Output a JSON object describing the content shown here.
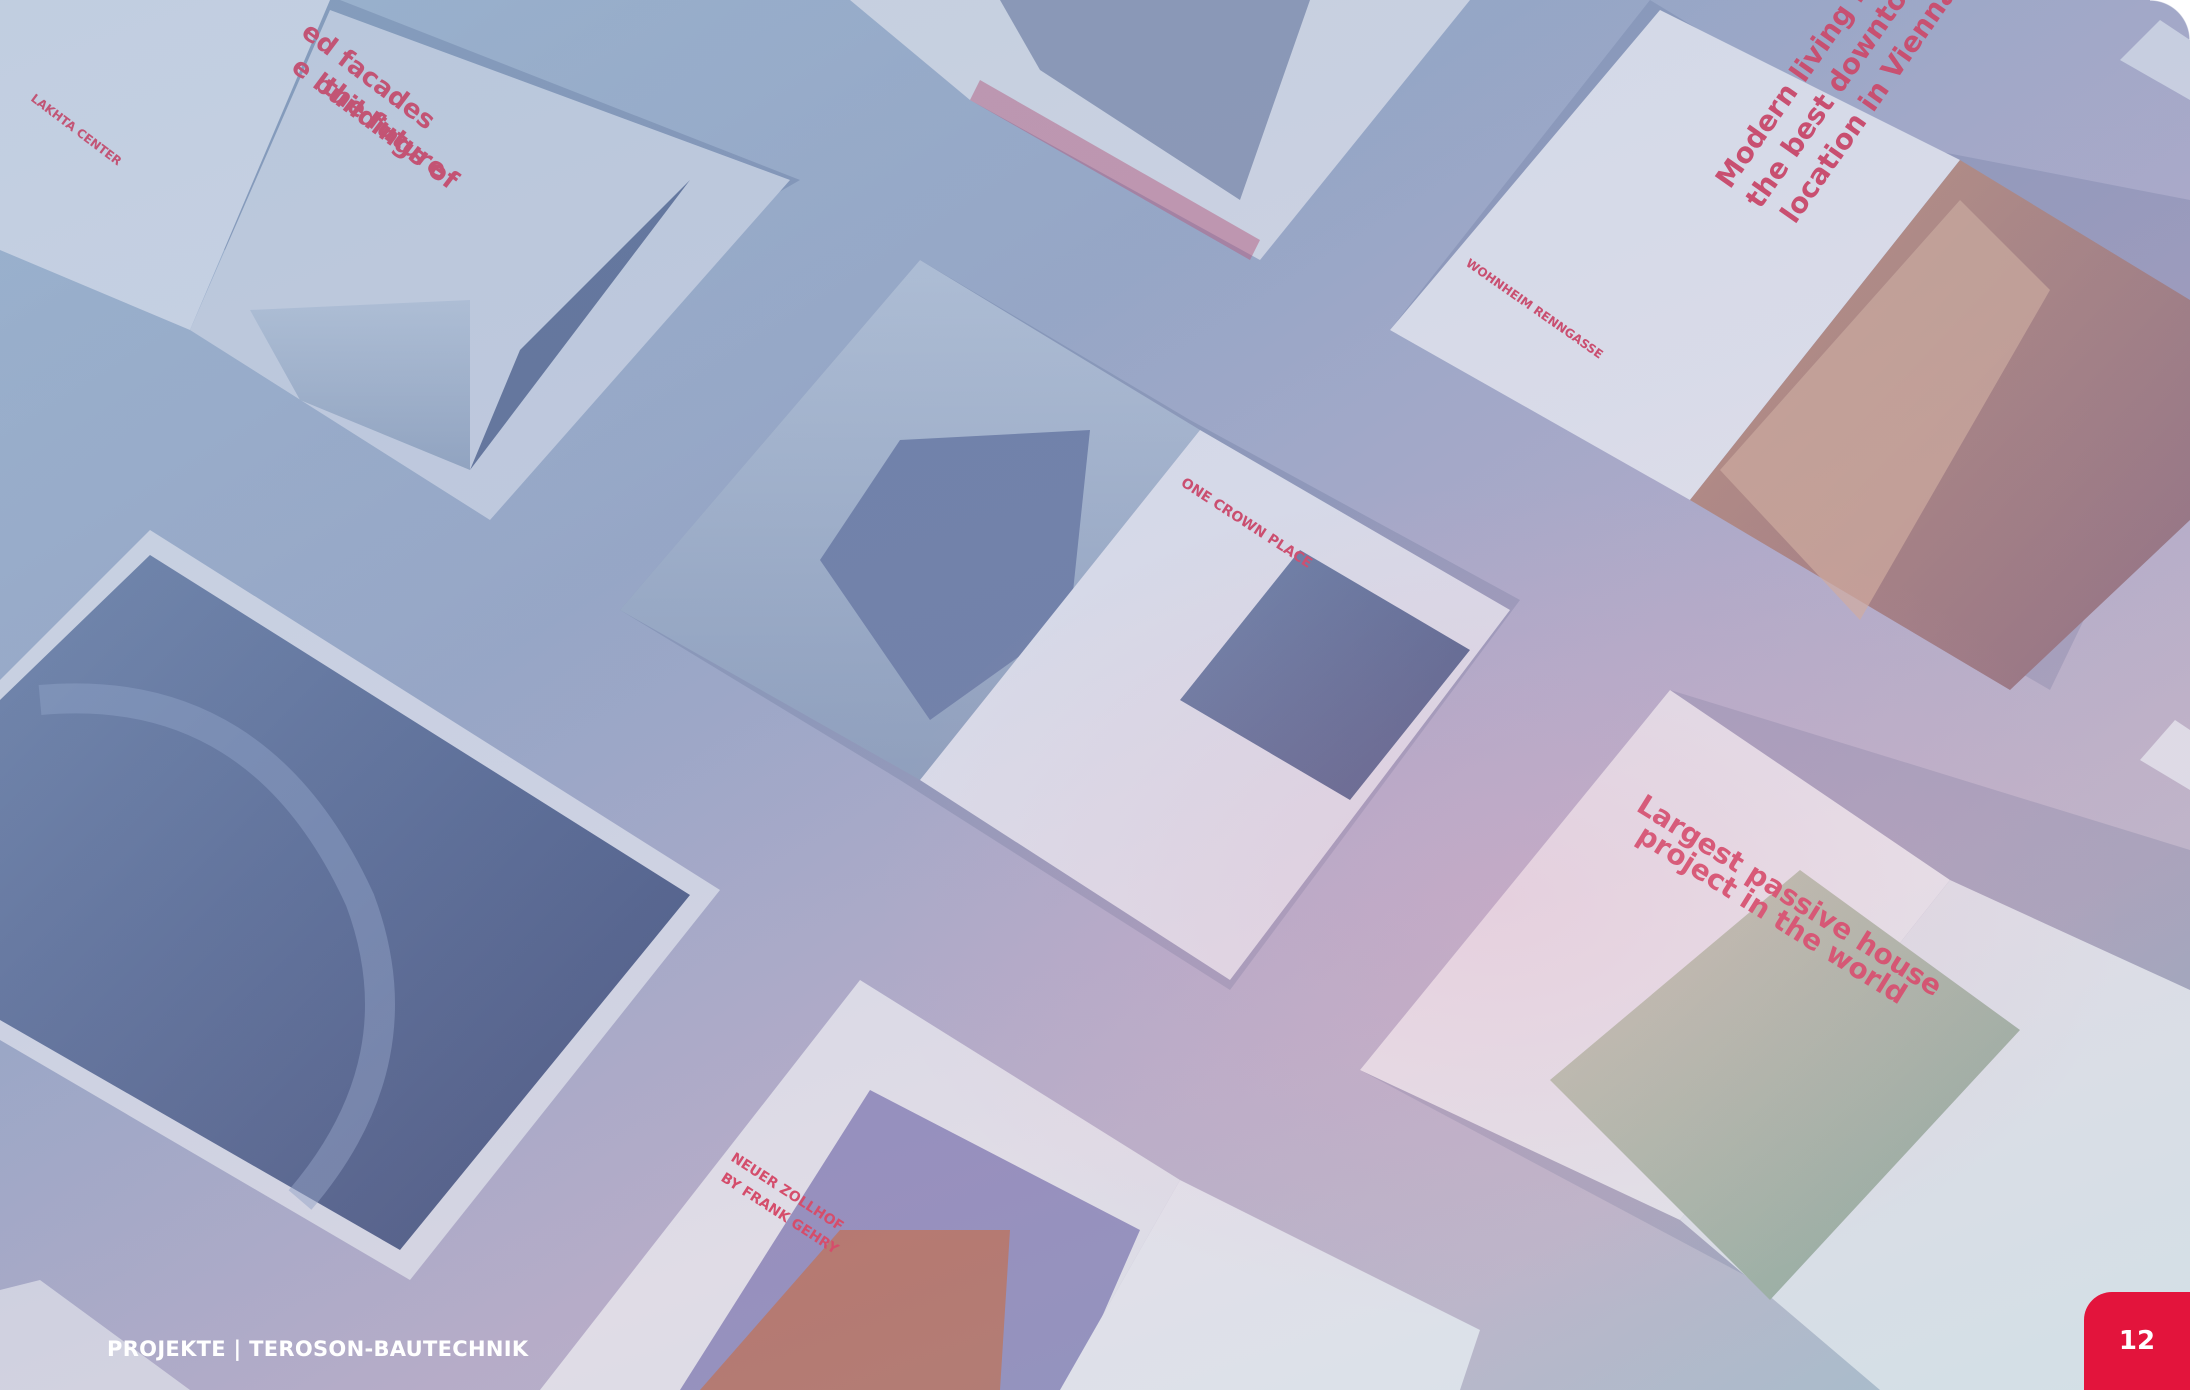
{
  "footer": {
    "label": "PROJEKTE | TEROSON-BAUTECHNIK"
  },
  "page_number": "12",
  "photo": {
    "description_name": "magazine-spreads-photo",
    "magazines": [
      {
        "name": "magazine-lakhta-center",
        "heading": "ed facades e buildings of the future",
        "subheading": "LAKHTA CENTER"
      },
      {
        "name": "magazine-wohnheim-renngasse",
        "heading": "Modern living in the best downtown location in Vienna",
        "subheading": "WOHNHEIM RENNGASSE"
      },
      {
        "name": "magazine-one-crown-place",
        "subheading": "ONE CROWN PLACE"
      },
      {
        "name": "magazine-passive-house",
        "heading": "Largest passive house project in the world"
      },
      {
        "name": "magazine-neuer-zollhof",
        "subheading": "NEUER ZOLLHOF BY FRANK GEHRY"
      }
    ]
  },
  "colors": {
    "accent": "#e3143c",
    "heading_red": "#d8405e",
    "footer_text": "#ffffff"
  }
}
